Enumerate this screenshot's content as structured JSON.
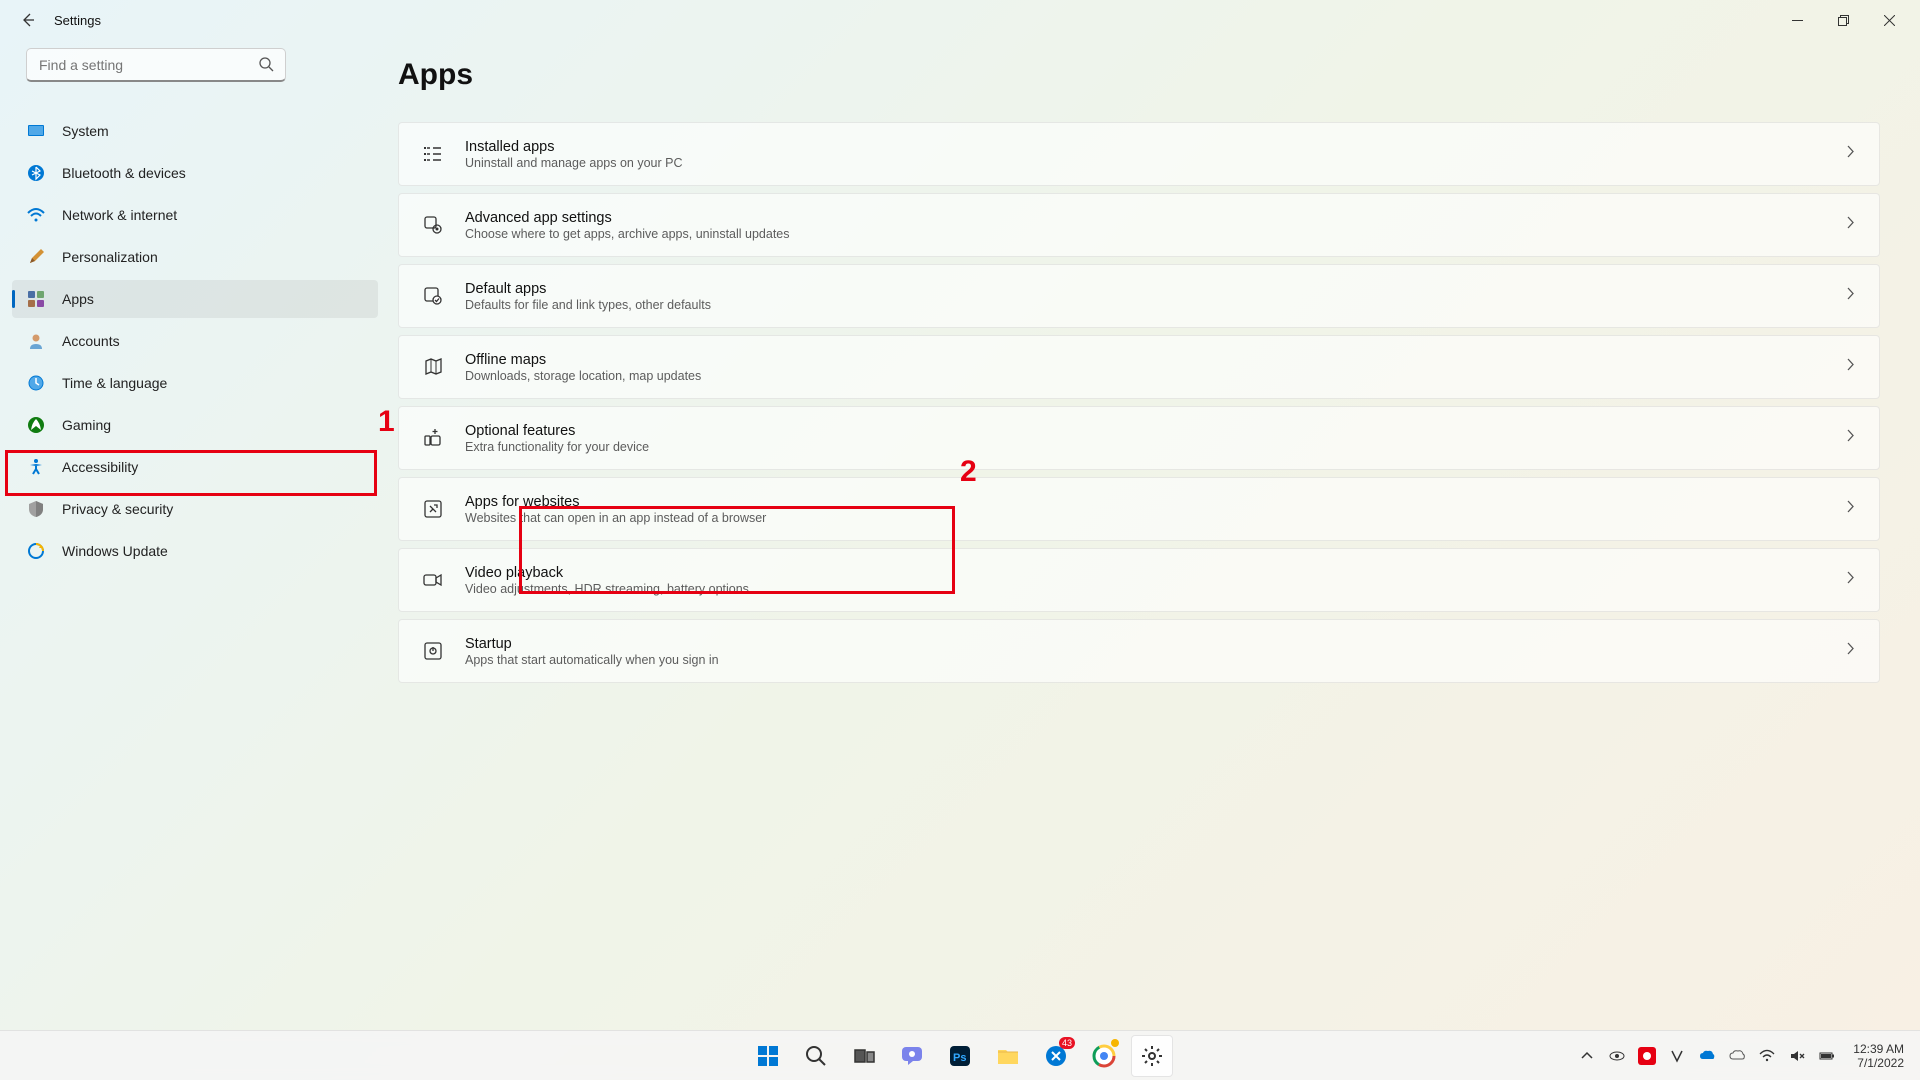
{
  "window": {
    "title": "Settings"
  },
  "search": {
    "placeholder": "Find a setting"
  },
  "sidebar": {
    "items": [
      {
        "label": "System"
      },
      {
        "label": "Bluetooth & devices"
      },
      {
        "label": "Network & internet"
      },
      {
        "label": "Personalization"
      },
      {
        "label": "Apps"
      },
      {
        "label": "Accounts"
      },
      {
        "label": "Time & language"
      },
      {
        "label": "Gaming"
      },
      {
        "label": "Accessibility"
      },
      {
        "label": "Privacy & security"
      },
      {
        "label": "Windows Update"
      }
    ]
  },
  "page": {
    "title": "Apps",
    "cards": [
      {
        "title": "Installed apps",
        "sub": "Uninstall and manage apps on your PC"
      },
      {
        "title": "Advanced app settings",
        "sub": "Choose where to get apps, archive apps, uninstall updates"
      },
      {
        "title": "Default apps",
        "sub": "Defaults for file and link types, other defaults"
      },
      {
        "title": "Offline maps",
        "sub": "Downloads, storage location, map updates"
      },
      {
        "title": "Optional features",
        "sub": "Extra functionality for your device"
      },
      {
        "title": "Apps for websites",
        "sub": "Websites that can open in an app instead of a browser"
      },
      {
        "title": "Video playback",
        "sub": "Video adjustments, HDR streaming, battery options"
      },
      {
        "title": "Startup",
        "sub": "Apps that start automatically when you sign in"
      }
    ]
  },
  "annotations": {
    "one": "1",
    "two": "2"
  },
  "taskbar": {
    "badge_count": "43",
    "time": "12:39 AM",
    "date": "7/1/2022"
  }
}
